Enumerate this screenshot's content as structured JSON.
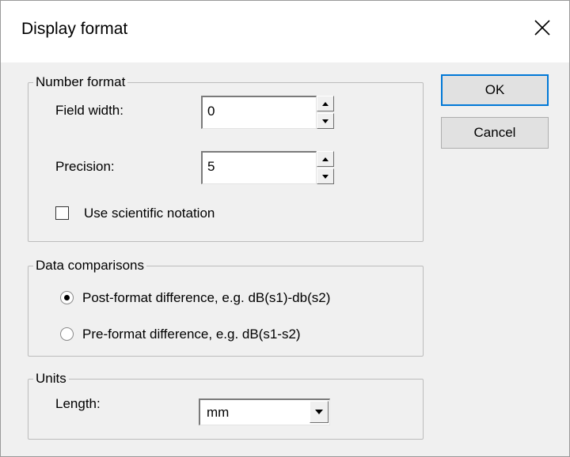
{
  "window": {
    "title": "Display format"
  },
  "number_format": {
    "group_label": "Number format",
    "field_width_label": "Field width:",
    "field_width_value": "0",
    "precision_label": "Precision:",
    "precision_value": "5",
    "scientific_label": "Use scientific notation",
    "scientific_checked": false
  },
  "data_comparisons": {
    "group_label": "Data comparisons",
    "options": [
      {
        "label": "Post-format difference, e.g. dB(s1)-db(s2)",
        "selected": true
      },
      {
        "label": "Pre-format difference, e.g. dB(s1-s2)",
        "selected": false
      }
    ]
  },
  "units": {
    "group_label": "Units",
    "length_label": "Length:",
    "length_value": "mm"
  },
  "buttons": {
    "ok": "OK",
    "cancel": "Cancel"
  },
  "icons": {
    "close": "close-icon",
    "spin_up": "spin-up-icon",
    "spin_down": "spin-down-icon",
    "dropdown": "chevron-down-icon"
  },
  "colors": {
    "accent": "#0078d7",
    "dialog_bg": "#f0f0f0"
  }
}
